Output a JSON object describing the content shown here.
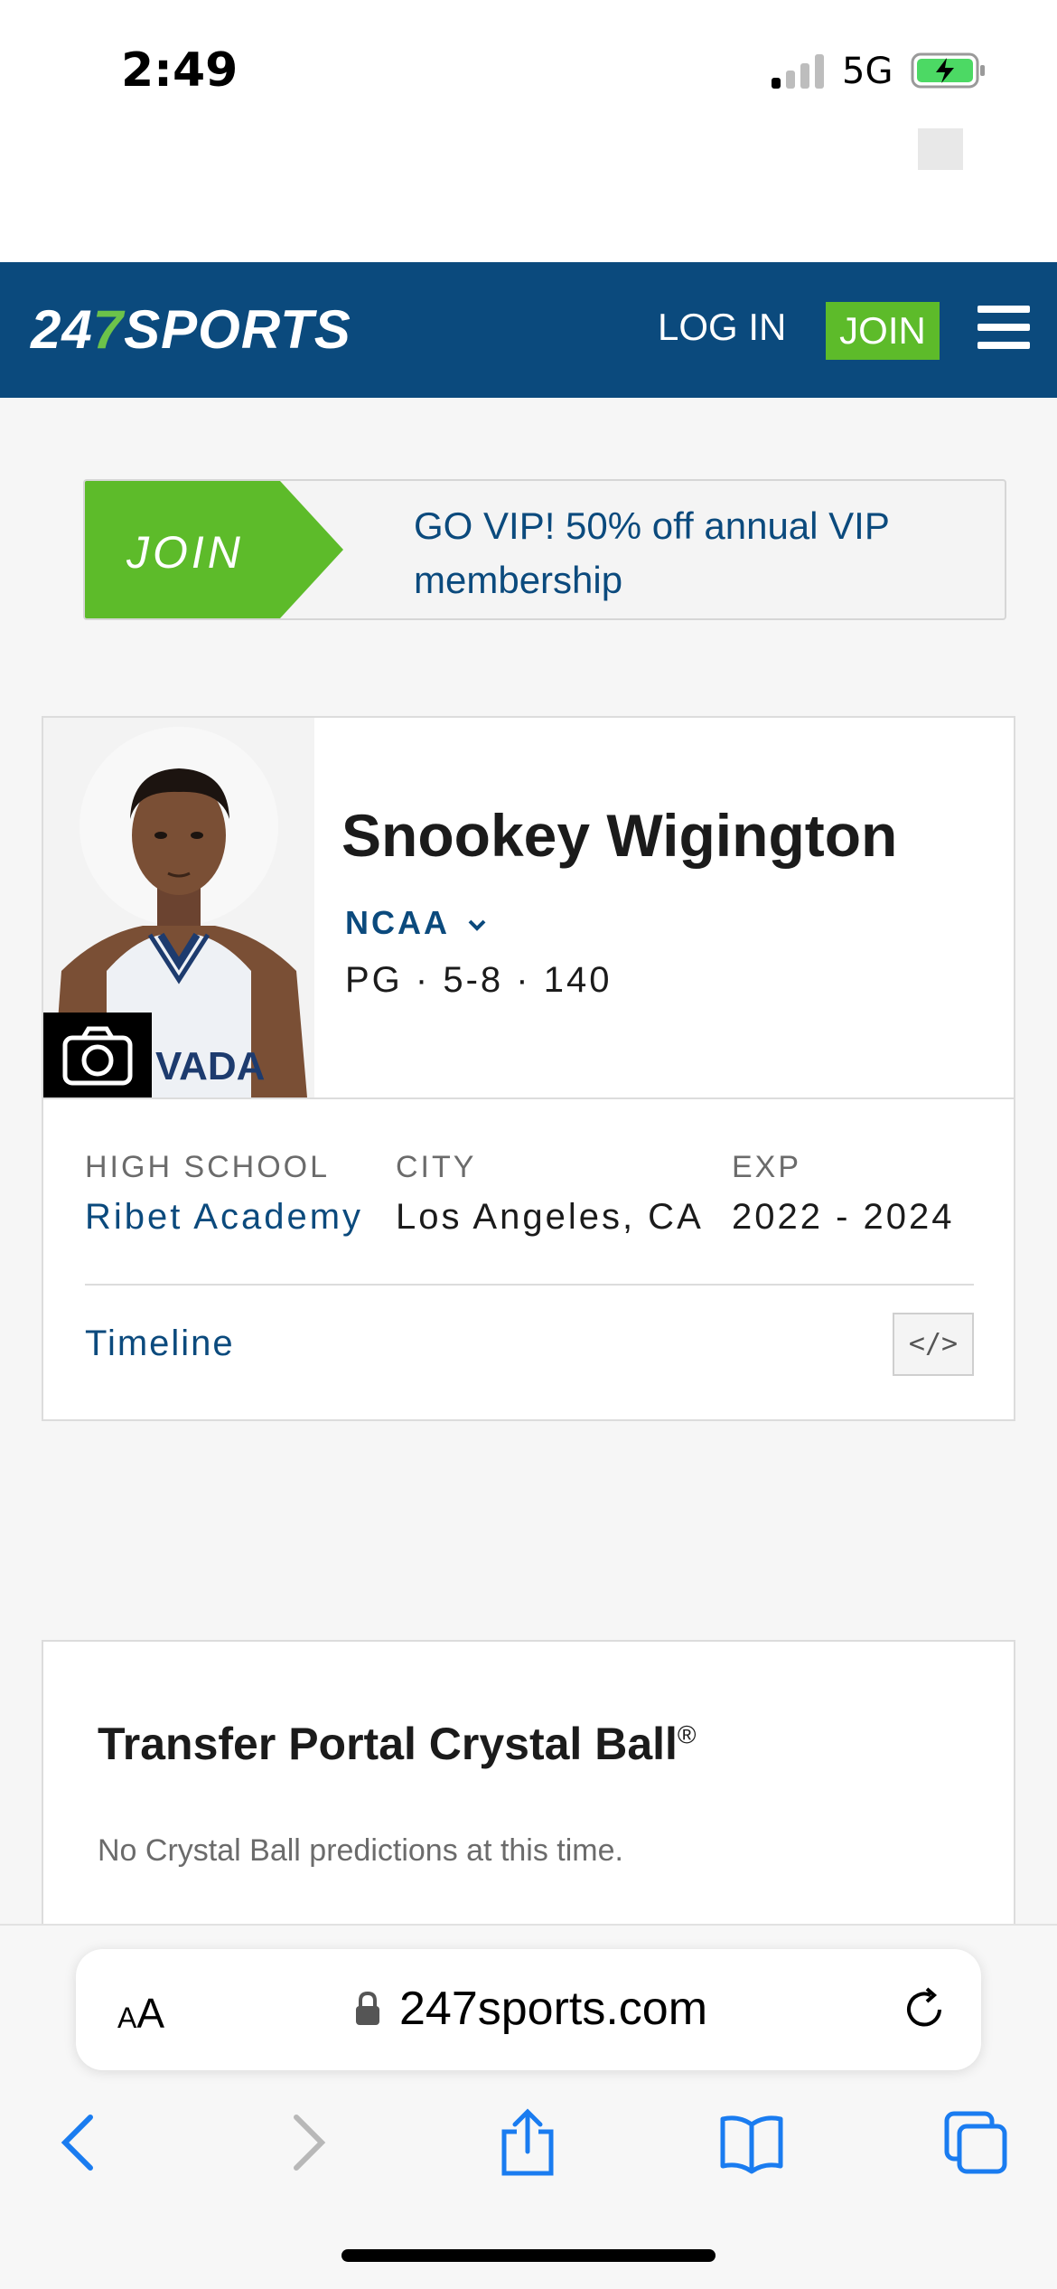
{
  "status_bar": {
    "time": "2:49",
    "network": "5G"
  },
  "header": {
    "logo_part1": "24",
    "logo_part2": "7",
    "logo_part3": "SPORTS",
    "login_label": "LOG IN",
    "join_label": "JOIN",
    "menu_icon": "hamburger-icon"
  },
  "vip_banner": {
    "join_label": "JOIN",
    "text": "GO VIP! 50% off annual VIP membership"
  },
  "player": {
    "name": "Snookey Wigington",
    "league": "NCAA",
    "position_line": "PG · 5-8 · 140",
    "jersey_text": "VADA",
    "camera_icon": "camera-icon",
    "high_school_label": "HIGH SCHOOL",
    "high_school": "Ribet Academy",
    "city_label": "CITY",
    "city": "Los Angeles, CA",
    "exp_label": "EXP",
    "exp": "2022 - 2024",
    "timeline_label": "Timeline",
    "embed_label": "</>"
  },
  "crystal_ball": {
    "title": "Transfer Portal Crystal Ball",
    "title_mark": "®",
    "empty_text": "No Crystal Ball predictions at this time."
  },
  "browser": {
    "aa_small": "A",
    "aa_large": "A",
    "url": "247sports.com"
  },
  "colors": {
    "brand_blue": "#0b4a7d",
    "brand_green": "#5dbb2a"
  }
}
